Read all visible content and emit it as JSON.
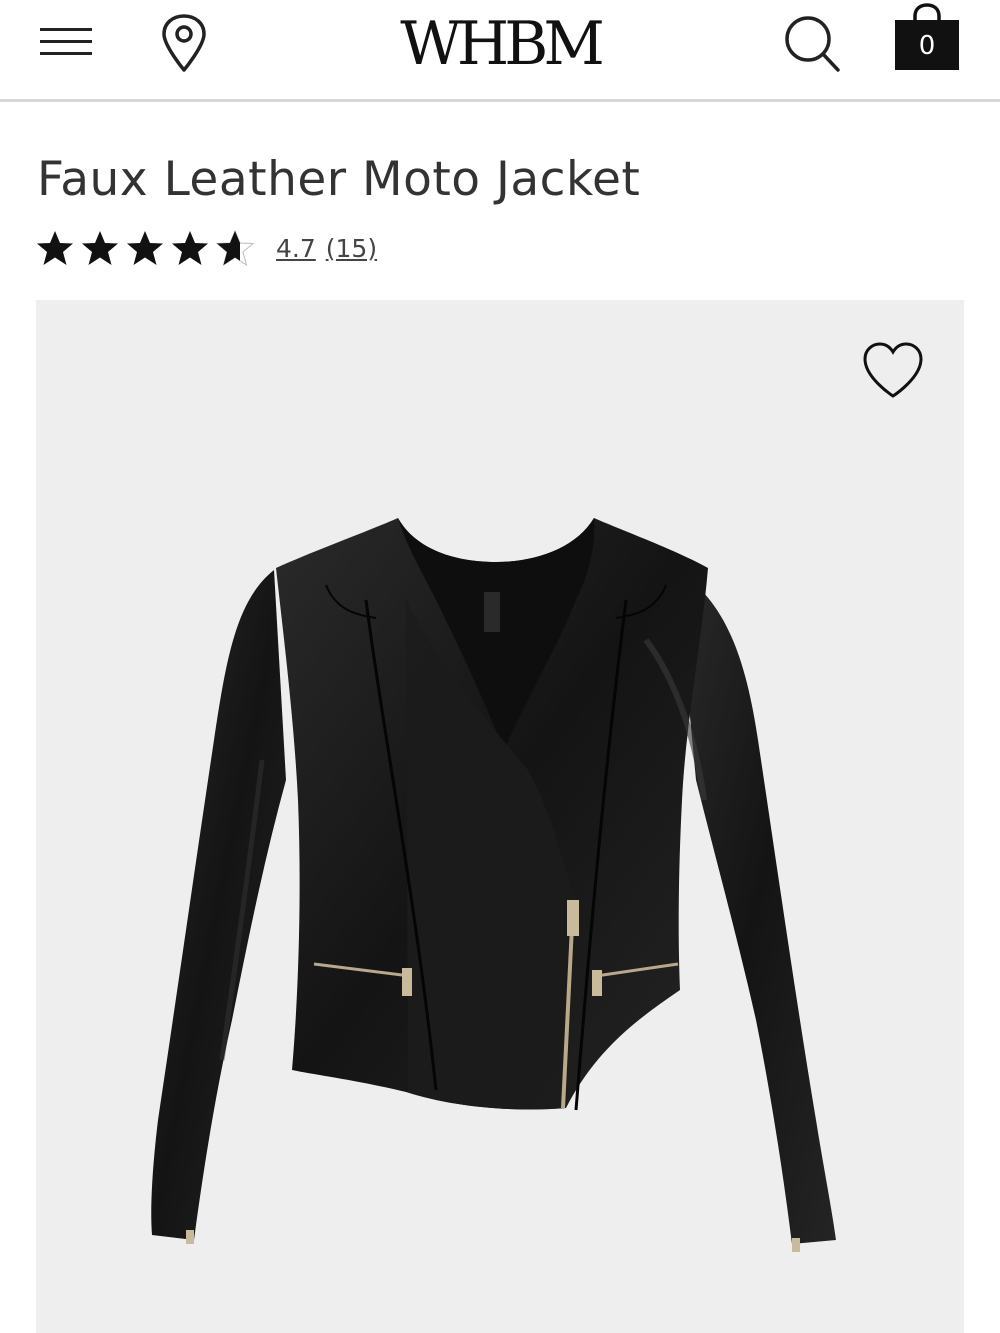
{
  "header": {
    "logo": "WHBM",
    "bag_count": "0",
    "icons": {
      "menu": "hamburger-menu-icon",
      "store": "location-pin-icon",
      "search": "search-icon",
      "bag": "shopping-bag-icon"
    }
  },
  "product": {
    "title": "Faux Leather Moto Jacket",
    "rating": {
      "value": "4.7",
      "count": "(15)",
      "stars_filled": 4.7,
      "stars_max": 5
    },
    "image": {
      "description_icon": "product-image",
      "wishlist_icon": "heart-icon"
    }
  },
  "colors": {
    "text": "#333333",
    "divider": "#d6d6d6",
    "image_bg": "#eeeeee",
    "jacket": "#1a1a1a",
    "zipper": "#b8a98a"
  }
}
